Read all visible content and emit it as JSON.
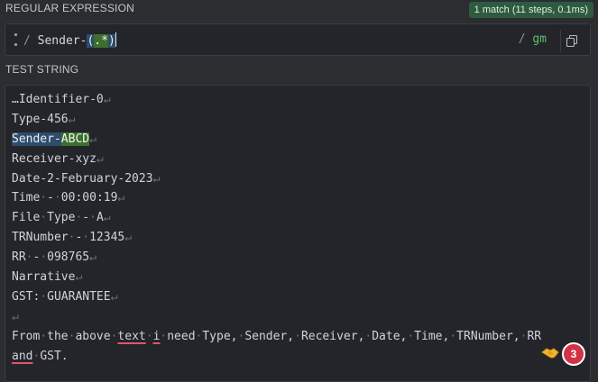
{
  "regex_section": {
    "label": "REGULAR EXPRESSION",
    "match_info": "1 match (11 steps, 0.1ms)",
    "delimiter_open": "/",
    "pattern_prefix": "Sender-",
    "group_open": "(",
    "group_inner": ".*",
    "group_close": ")",
    "delimiter_close": "/",
    "flags": "gm"
  },
  "test_section": {
    "label": "TEST STRING",
    "lines": [
      {
        "text": "…Identifier-0"
      },
      {
        "text": "Type-456"
      },
      {
        "text": "Sender-ABCD"
      },
      {
        "text": "Receiver-xyz"
      },
      {
        "text": "Date-2-February-2023"
      },
      {
        "text": "Time - 00:00:19"
      },
      {
        "text": "File Type - A"
      },
      {
        "text": "TRNumber - 12345"
      },
      {
        "text": "RR - 098765"
      },
      {
        "text": "Narrative"
      },
      {
        "text": "GST: GUARANTEE"
      },
      {
        "text": ""
      },
      {
        "text": "From the above text i need Type, Sender, Receiver, Date, Time, TRNumber, RR"
      },
      {
        "text": "and GST."
      }
    ],
    "match_full": "Sender-",
    "match_group": "ABCD",
    "notification_count": "3"
  },
  "icons": {
    "copy": "copy-icon",
    "grip": "drag-handle-icon",
    "hand": "handshake-icon"
  },
  "colors": {
    "match_full_bg": "#2e4d6b",
    "match_group_bg": "#3d6e2e",
    "badge_green": "#2f5a3f",
    "spell_error": "#e0566a",
    "notification_red": "#d23245"
  }
}
